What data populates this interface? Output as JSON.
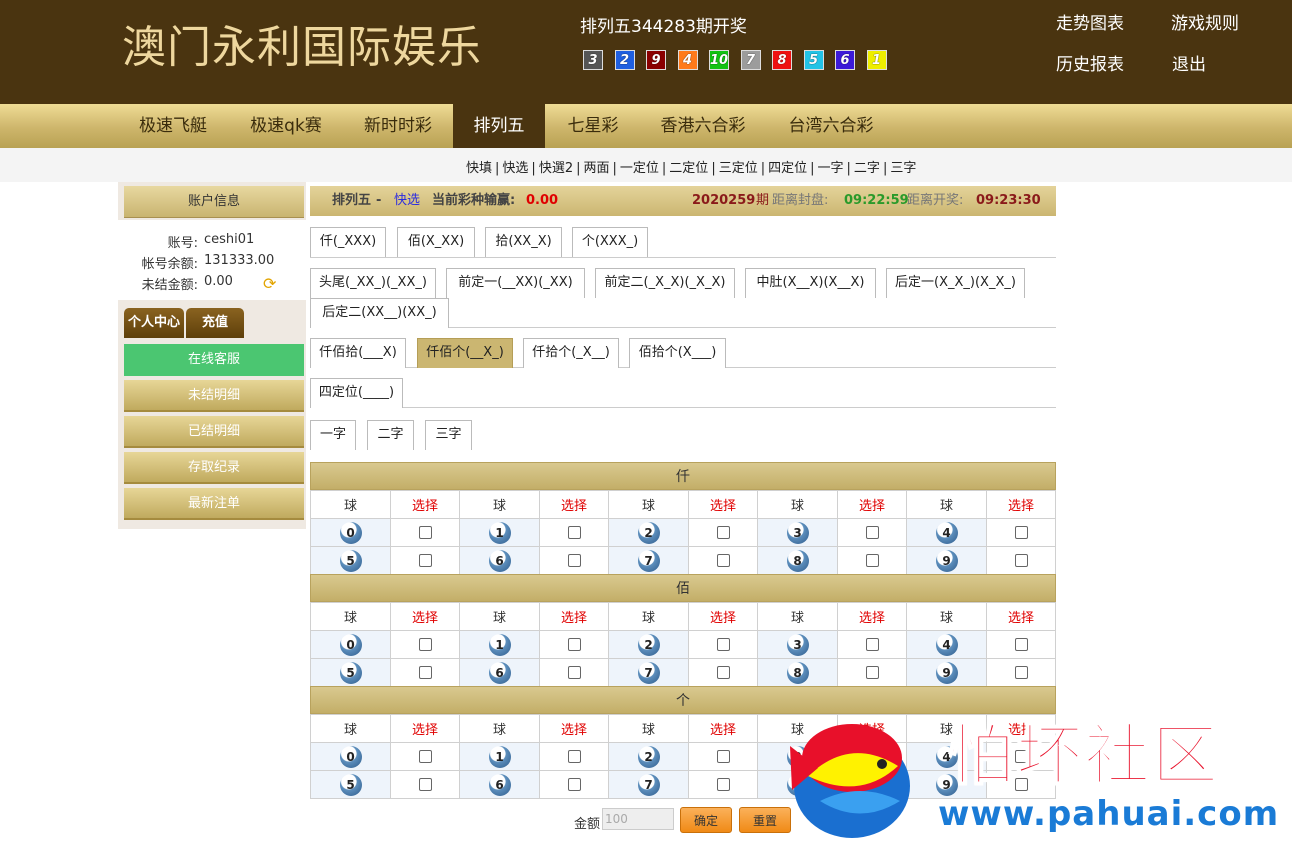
{
  "header": {
    "logo": "澳门永利国际娱乐",
    "draw_title": "排列五344283期开奖",
    "draw_balls": [
      {
        "num": "3",
        "color": "#555555"
      },
      {
        "num": "2",
        "color": "#1f5fe0"
      },
      {
        "num": "9",
        "color": "#8a0000"
      },
      {
        "num": "4",
        "color": "#ff7a1a"
      },
      {
        "num": "10",
        "color": "#12c212"
      },
      {
        "num": "7",
        "color": "#9c9c9c"
      },
      {
        "num": "8",
        "color": "#ee1111"
      },
      {
        "num": "5",
        "color": "#22c3e6"
      },
      {
        "num": "6",
        "color": "#3b1ad8"
      },
      {
        "num": "1",
        "color": "#eeee00"
      }
    ],
    "links": {
      "trend": "走势图表",
      "rules": "游戏规则",
      "history": "历史报表",
      "logout": "退出"
    }
  },
  "nav": {
    "items": [
      "极速飞艇",
      "极速qk赛",
      "新时时彩",
      "排列五",
      "七星彩",
      "香港六合彩",
      "台湾六合彩"
    ],
    "active": "排列五"
  },
  "subnav": [
    "快填",
    "快选",
    "快選2",
    "两面",
    "一定位",
    "二定位",
    "三定位",
    "四定位",
    "一字",
    "二字",
    "三字"
  ],
  "sidebar": {
    "account_title": "账户信息",
    "account_label": "账号:",
    "account_value": "ceshi01",
    "balance_label": "帐号余额:",
    "balance_value": "131333.00",
    "unsettled_label": "未结金额:",
    "unsettled_value": "0.00",
    "personal_center": "个人中心",
    "recharge": "充值",
    "menu": [
      "在线客服",
      "未结明细",
      "已结明细",
      "存取纪录",
      "最新注单"
    ]
  },
  "infobar": {
    "game": "排列五",
    "dash": "-",
    "mode": "快选",
    "odds_label": "当前彩种输赢:",
    "odds_value": "0.00",
    "period": "2020259",
    "period_unit": "期",
    "close_label": "距离封盘:",
    "close_time": "09:22:59",
    "open_label": "距离开奖:",
    "open_time": "09:23:30"
  },
  "tabs": {
    "row1": [
      "仟(_XXX)",
      "佰(X_XX)",
      "拾(XX_X)",
      "个(XXX_)"
    ],
    "row2a": [
      "头尾(_XX_)(_XX_)",
      "前定一(__XX)(_XX)",
      "前定二(_X_X)(_X_X)",
      "中肚(X__X)(X__X)",
      "后定一(X_X_)(X_X_)"
    ],
    "row2b": [
      "后定二(XX__)(XX_)"
    ],
    "row3": [
      "仟佰拾(___X)",
      "仟佰个(__X_)",
      "仟拾个(_X__)",
      "佰拾个(X___)"
    ],
    "row3_active": "仟佰个(__X_)",
    "row4": [
      "四定位(____)"
    ],
    "row5": [
      "一字",
      "二字",
      "三字"
    ]
  },
  "sections": [
    {
      "title": "仟"
    },
    {
      "title": "佰"
    },
    {
      "title": "个"
    }
  ],
  "table": {
    "col_ball": "球",
    "col_select": "选择",
    "row1": [
      "0",
      "1",
      "2",
      "3",
      "4"
    ],
    "row2": [
      "5",
      "6",
      "7",
      "8",
      "9"
    ]
  },
  "bottom": {
    "amount_label": "金额",
    "amount_value": "100",
    "confirm": "确定",
    "reset": "重置"
  },
  "watermark": {
    "text": "怕坏社区",
    "url": "www.pahuai.com"
  }
}
